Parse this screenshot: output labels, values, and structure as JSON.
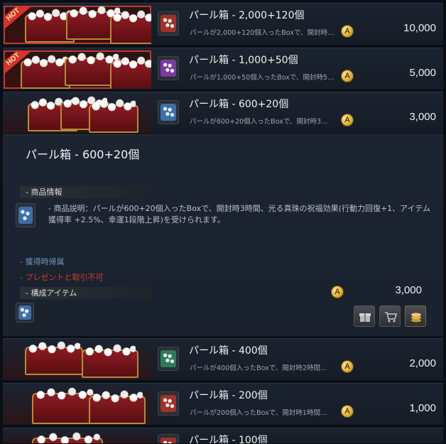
{
  "items": [
    {
      "title": "パール箱 - 2,000+120個",
      "desc": "パールが2,000+120個入ったBoxで、開封時…",
      "price": "10,000",
      "hot": true,
      "hot_label": "HOT",
      "currency": "A",
      "color": "#a0322c"
    },
    {
      "title": "パール箱 - 1,000+50個",
      "desc": "パールが1,000+50個入ったBoxで、開封時5…",
      "price": "5,000",
      "hot": true,
      "hot_label": "HOT",
      "currency": "A",
      "color": "#7b3aa0"
    },
    {
      "title": "パール箱 - 600+20個",
      "desc": "パールが600+20個入ったBoxで、開封時3…",
      "price": "3,000",
      "hot": false,
      "currency": "A",
      "color": "#3b6fa8"
    },
    {
      "title": "パール箱 - 400個",
      "desc": "パールが400個入ったBoxで、開封時2時間…",
      "price": "2,000",
      "hot": false,
      "currency": "A",
      "color": "#2f7a5a"
    },
    {
      "title": "パール箱 - 200個",
      "desc": "パールが200個入ったBoxで、開封時1時間…",
      "price": "1,000",
      "hot": false,
      "currency": "A",
      "color": "#a0322c"
    },
    {
      "title": "パール箱 - 100個",
      "desc": "",
      "price": "",
      "hot": false,
      "currency": "A",
      "color": "#a0322c"
    }
  ],
  "detail": {
    "title": "パール箱 - 600+20個",
    "section_info": "- 商品情報",
    "description": "- 商品説明：パールが600+20個入ったBoxで、開封時3時間、光る真珠の祝福効果(行動力回復+1、アイテム獲得率 +2.5%、幸運1段階上昇)を受けられます。",
    "bound_on_obtain": "- 獲得時帰属",
    "no_gift_trade": "- プレゼントと取引不可",
    "section_components": "- 構成アイテム",
    "price": "3,000",
    "currency": "A",
    "buttons": [
      {
        "name": "gift-button",
        "icon": "gift-icon"
      },
      {
        "name": "cart-button",
        "icon": "cart-icon"
      },
      {
        "name": "buy-button",
        "icon": "coins-icon"
      }
    ]
  },
  "colors": {
    "accent_red": "#c0392b",
    "meta_blue": "#6f93b8",
    "meta_red": "#d43a2a"
  }
}
